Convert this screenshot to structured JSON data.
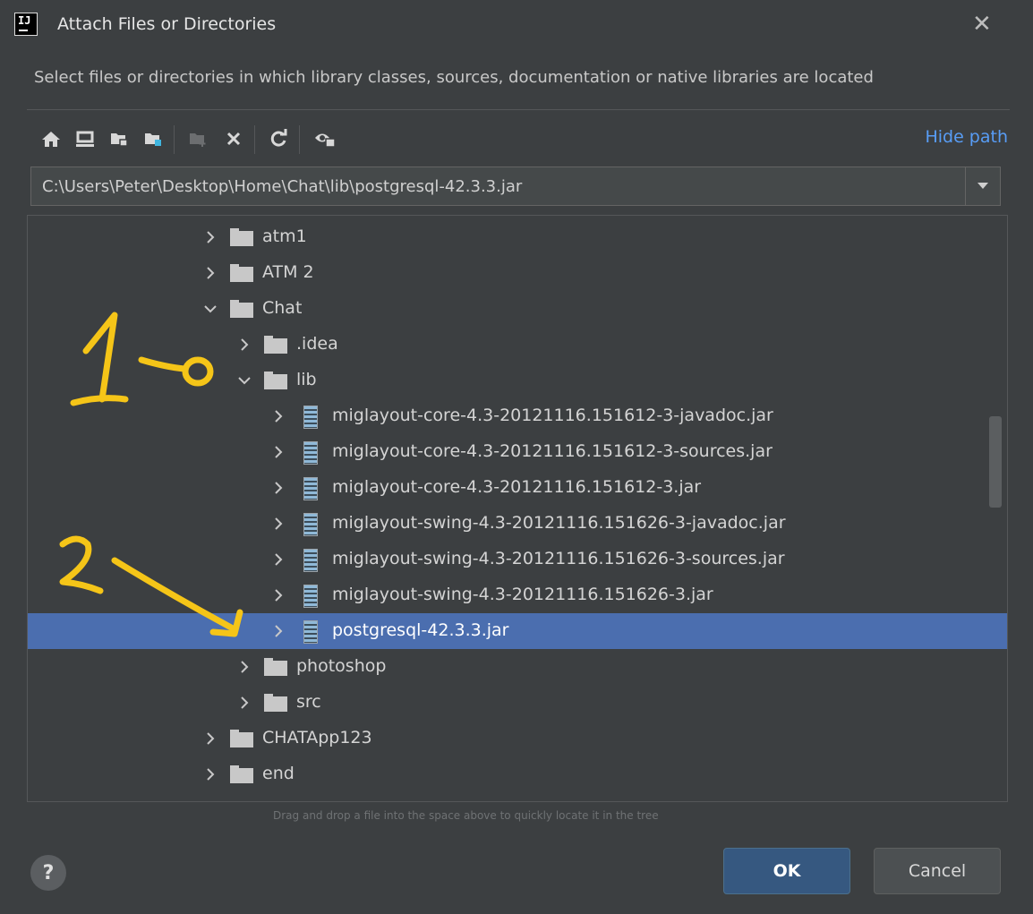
{
  "window": {
    "title": "Attach Files or Directories",
    "logo_text": "IJ"
  },
  "description": "Select files or directories in which library classes, sources, documentation or native libraries are located",
  "toolbar": {
    "icons": [
      "home-icon",
      "desktop-icon",
      "project-folder-icon",
      "module-folder-icon",
      "new-folder-icon",
      "delete-icon",
      "refresh-icon",
      "show-hidden-icon"
    ],
    "hide_path_label": "Hide path"
  },
  "path": {
    "value": "C:\\Users\\Peter\\Desktop\\Home\\Chat\\lib\\postgresql-42.3.3.jar"
  },
  "tree": {
    "rows": [
      {
        "label": "atm1",
        "type": "folder",
        "expanded": false,
        "depth": 0
      },
      {
        "label": "ATM 2",
        "type": "folder",
        "expanded": false,
        "depth": 0
      },
      {
        "label": "Chat",
        "type": "folder",
        "expanded": true,
        "depth": 0
      },
      {
        "label": ".idea",
        "type": "folder",
        "expanded": false,
        "depth": 1
      },
      {
        "label": "lib",
        "type": "folder",
        "expanded": true,
        "depth": 1
      },
      {
        "label": "miglayout-core-4.3-20121116.151612-3-javadoc.jar",
        "type": "jar",
        "expanded": false,
        "depth": 2
      },
      {
        "label": "miglayout-core-4.3-20121116.151612-3-sources.jar",
        "type": "jar",
        "expanded": false,
        "depth": 2
      },
      {
        "label": "miglayout-core-4.3-20121116.151612-3.jar",
        "type": "jar",
        "expanded": false,
        "depth": 2
      },
      {
        "label": "miglayout-swing-4.3-20121116.151626-3-javadoc.jar",
        "type": "jar",
        "expanded": false,
        "depth": 2
      },
      {
        "label": "miglayout-swing-4.3-20121116.151626-3-sources.jar",
        "type": "jar",
        "expanded": false,
        "depth": 2
      },
      {
        "label": "miglayout-swing-4.3-20121116.151626-3.jar",
        "type": "jar",
        "expanded": false,
        "depth": 2
      },
      {
        "label": "postgresql-42.3.3.jar",
        "type": "jar",
        "expanded": false,
        "depth": 2,
        "selected": true
      },
      {
        "label": "photoshop",
        "type": "folder",
        "expanded": false,
        "depth": 1
      },
      {
        "label": "src",
        "type": "folder",
        "expanded": false,
        "depth": 1
      },
      {
        "label": "CHATApp123",
        "type": "folder",
        "expanded": false,
        "depth": 0
      },
      {
        "label": "end",
        "type": "folder",
        "expanded": false,
        "depth": 0
      },
      {
        "label": "",
        "type": "folder",
        "expanded": false,
        "depth": 0
      }
    ]
  },
  "hint": "Drag and drop a file into the space above to quickly locate it in the tree",
  "buttons": {
    "help_label": "?",
    "ok_label": "OK",
    "cancel_label": "Cancel"
  },
  "annotations": [
    {
      "text": "1",
      "color": "#f5c518"
    },
    {
      "text": "2",
      "color": "#f5c518"
    }
  ],
  "colors": {
    "background": "#3c3f41",
    "selection": "#4b6eaf",
    "link": "#589df6",
    "annotation": "#f5c518"
  }
}
